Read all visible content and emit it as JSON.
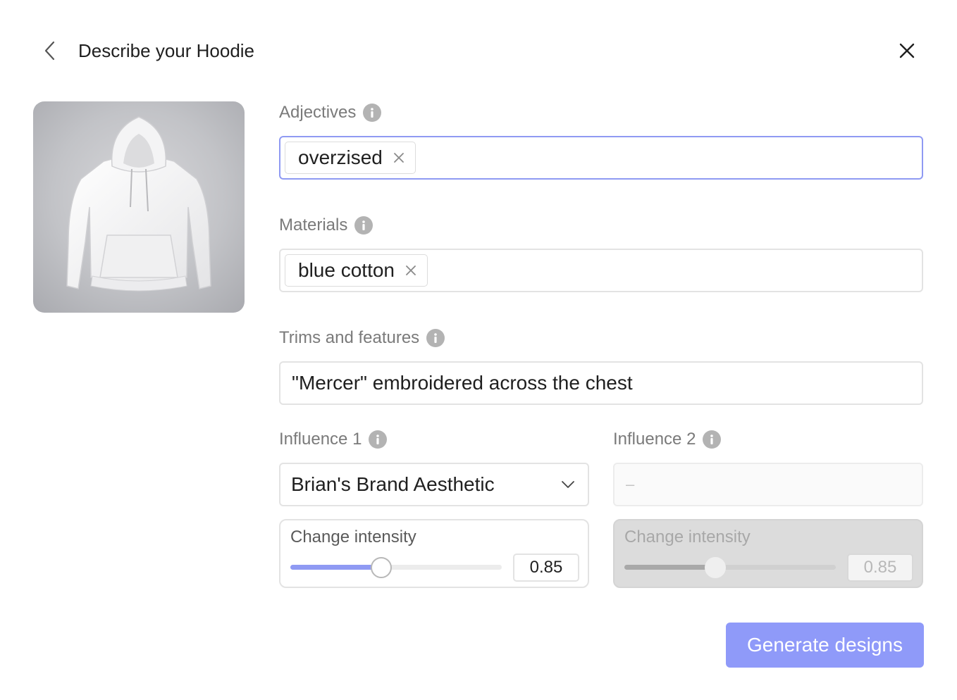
{
  "header": {
    "title": "Describe your Hoodie"
  },
  "preview": {
    "alt": "White hoodie product photo"
  },
  "adjectives": {
    "label": "Adjectives",
    "chips": [
      "overzised"
    ]
  },
  "materials": {
    "label": "Materials",
    "chips": [
      "blue cotton"
    ]
  },
  "trims": {
    "label": "Trims and features",
    "value": "\"Mercer\" embroidered across the chest"
  },
  "influence1": {
    "label": "Influence 1",
    "selected": "Brian's Brand Aesthetic",
    "intensity_label": "Change intensity",
    "intensity_value": "0.85",
    "slider_fraction": 0.43
  },
  "influence2": {
    "label": "Influence 2",
    "placeholder": "–",
    "intensity_label": "Change intensity",
    "intensity_value": "0.85",
    "slider_fraction": 0.43
  },
  "actions": {
    "generate_label": "Generate designs"
  },
  "colors": {
    "accent": "#8f9af3",
    "button": "#8f9af9"
  }
}
